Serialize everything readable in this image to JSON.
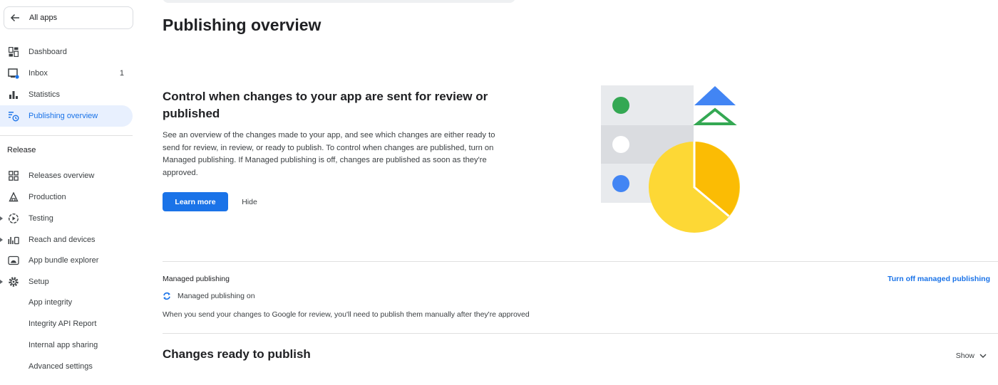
{
  "sidebar": {
    "all_apps": "All apps",
    "items": [
      {
        "label": "Dashboard",
        "icon": "dashboard-icon"
      },
      {
        "label": "Inbox",
        "icon": "inbox-icon",
        "count": "1"
      },
      {
        "label": "Statistics",
        "icon": "statistics-icon"
      },
      {
        "label": "Publishing overview",
        "icon": "publishing-overview-icon",
        "active": true
      }
    ],
    "release_section": "Release",
    "release_items": [
      {
        "label": "Releases overview",
        "icon": "releases-overview-icon"
      },
      {
        "label": "Production",
        "icon": "production-icon"
      },
      {
        "label": "Testing",
        "icon": "testing-icon"
      },
      {
        "label": "Reach and devices",
        "icon": "reach-devices-icon"
      },
      {
        "label": "App bundle explorer",
        "icon": "app-bundle-icon"
      },
      {
        "label": "Setup",
        "icon": "setup-gear-icon"
      }
    ],
    "setup_items": [
      {
        "label": "App integrity"
      },
      {
        "label": "Integrity API Report"
      },
      {
        "label": "Internal app sharing"
      },
      {
        "label": "Advanced settings"
      }
    ]
  },
  "main": {
    "page_title": "Publishing overview",
    "hero": {
      "title": "Control when changes to your app are sent for review or published",
      "body": "See an overview of the changes made to your app, and see which changes are either ready to send for review, in review, or ready to publish. To control when changes are published, turn on Managed publishing. If Managed publishing is off, changes are published as soon as they're approved.",
      "learn_more": "Learn more",
      "hide": "Hide"
    },
    "managed_publishing": {
      "title": "Managed publishing",
      "status": "Managed publishing on",
      "description": "When you send your changes to Google for review, you'll need to publish them manually after they're approved",
      "turn_off": "Turn off managed publishing"
    },
    "changes": {
      "title": "Changes ready to publish",
      "show": "Show"
    }
  },
  "colors": {
    "accent": "#1a73e8",
    "active_bg": "#e8f0fe",
    "green": "#34a853",
    "blue": "#4285f4",
    "yellow": "#fdd835",
    "yellow_dark": "#fbbc04"
  }
}
